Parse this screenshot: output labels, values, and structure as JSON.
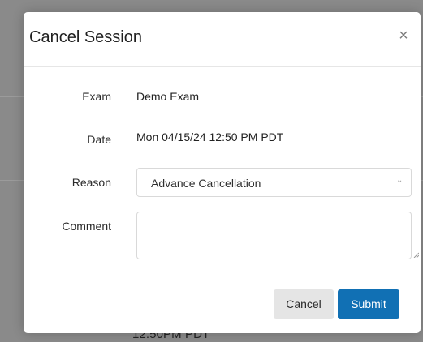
{
  "background": {
    "visible_text": "12:50PM PDT"
  },
  "modal": {
    "title": "Cancel Session",
    "close_label": "×",
    "fields": {
      "exam_label": "Exam",
      "exam_value": "Demo Exam",
      "date_label": "Date",
      "date_value": "Mon 04/15/24 12:50 PM PDT",
      "reason_label": "Reason",
      "reason_value": "Advance Cancellation",
      "comment_label": "Comment",
      "comment_value": ""
    },
    "buttons": {
      "cancel": "Cancel",
      "submit": "Submit"
    }
  },
  "colors": {
    "submit": "#1170b4",
    "cancel": "#e5e5e5",
    "overlay": "#8a8a8a"
  },
  "icons": {
    "close": "close-icon",
    "chevron": "chevron-down-icon",
    "resize": "resize-handle-icon"
  }
}
